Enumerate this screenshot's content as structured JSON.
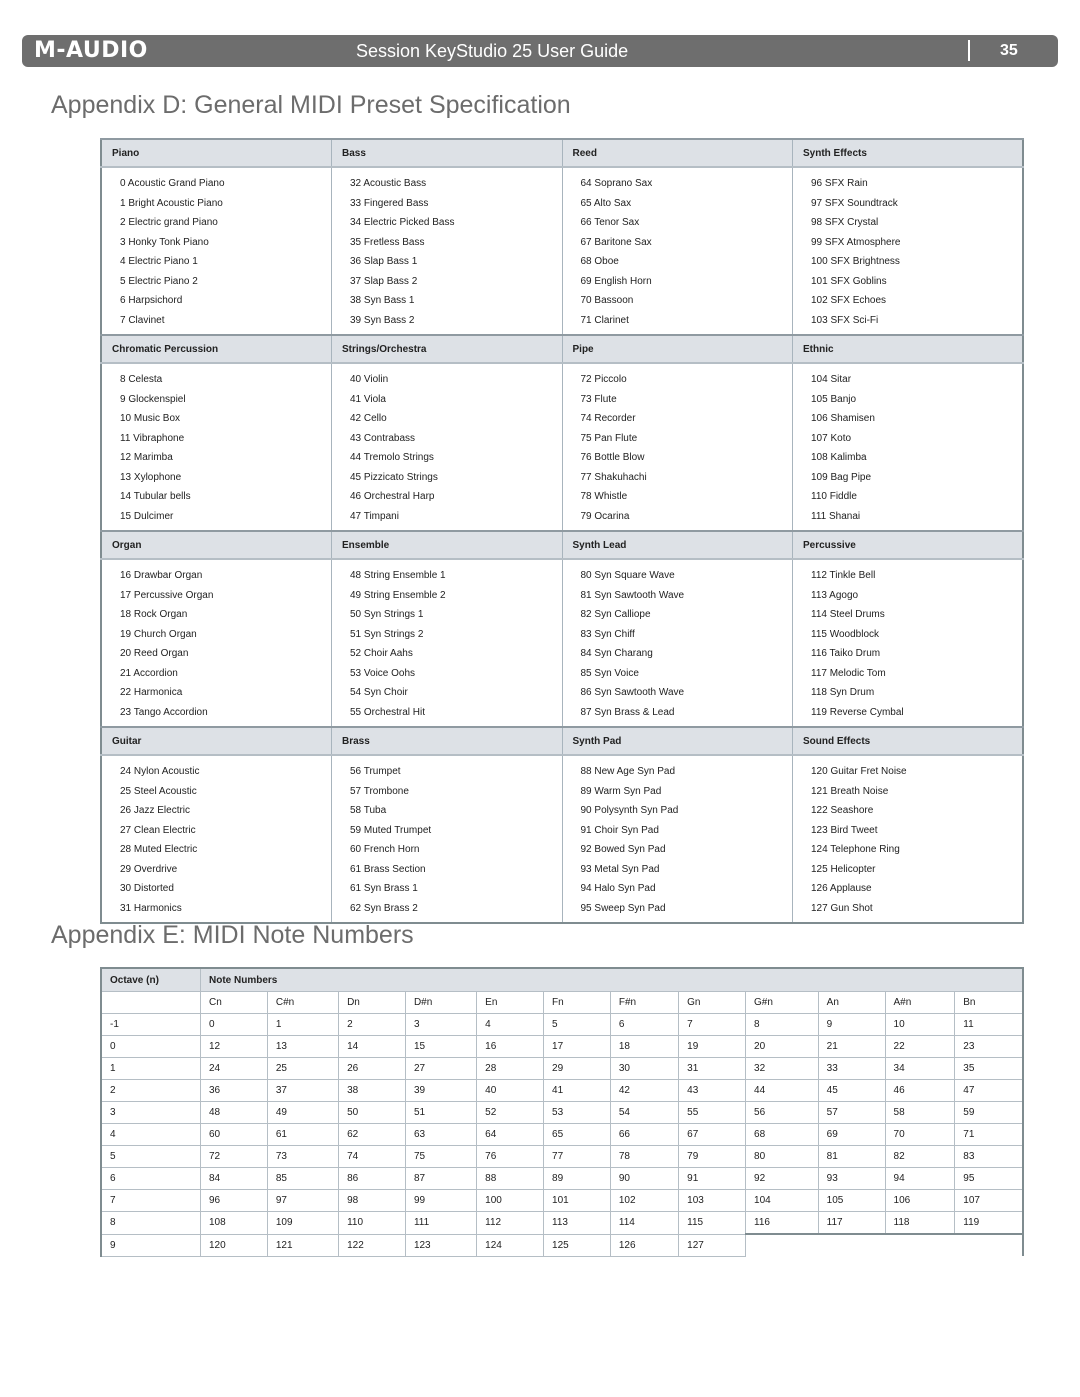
{
  "header": {
    "brand": "M-AUDIO",
    "doc_title": "Session KeyStudio 25 User Guide",
    "page": "35"
  },
  "appendix_d": {
    "title": "Appendix D:  General MIDI Preset Specification",
    "groups": [
      [
        {
          "name": "Piano",
          "items": [
            "0 Acoustic Grand Piano",
            "1 Bright Acoustic Piano",
            "2 Electric grand Piano",
            "3 Honky Tonk Piano",
            "4 Electric Piano 1",
            "5 Electric Piano 2",
            "6 Harpsichord",
            "7 Clavinet"
          ]
        },
        {
          "name": "Bass",
          "items": [
            "32 Acoustic Bass",
            "33 Fingered Bass",
            "34 Electric Picked Bass",
            "35 Fretless Bass",
            "36 Slap Bass 1",
            "37 Slap Bass 2",
            "38 Syn Bass 1",
            "39 Syn Bass 2"
          ]
        },
        {
          "name": "Reed",
          "items": [
            "64 Soprano Sax",
            "65 Alto Sax",
            "66 Tenor Sax",
            "67 Baritone Sax",
            "68 Oboe",
            "69 English Horn",
            "70 Bassoon",
            "71 Clarinet"
          ]
        },
        {
          "name": "Synth Effects",
          "items": [
            "96 SFX Rain",
            "97 SFX Soundtrack",
            "98 SFX Crystal",
            "99 SFX Atmosphere",
            "100 SFX Brightness",
            "101 SFX Goblins",
            "102 SFX Echoes",
            "103 SFX Sci-Fi"
          ]
        }
      ],
      [
        {
          "name": "Chromatic Percussion",
          "items": [
            "8 Celesta",
            "9 Glockenspiel",
            "10 Music Box",
            "11 Vibraphone",
            "12 Marimba",
            "13 Xylophone",
            "14 Tubular bells",
            "15 Dulcimer"
          ]
        },
        {
          "name": "Strings/Orchestra",
          "items": [
            "40 Violin",
            "41 Viola",
            "42 Cello",
            "43 Contrabass",
            "44 Tremolo Strings",
            "45 Pizzicato Strings",
            "46 Orchestral Harp",
            "47 Timpani"
          ]
        },
        {
          "name": "Pipe",
          "items": [
            "72 Piccolo",
            "73 Flute",
            "74 Recorder",
            "75 Pan Flute",
            "76 Bottle Blow",
            "77 Shakuhachi",
            "78 Whistle",
            "79 Ocarina"
          ]
        },
        {
          "name": "Ethnic",
          "items": [
            "104 Sitar",
            "105 Banjo",
            "106 Shamisen",
            "107 Koto",
            "108 Kalimba",
            "109 Bag Pipe",
            "110 Fiddle",
            "111 Shanai"
          ]
        }
      ],
      [
        {
          "name": "Organ",
          "items": [
            "16 Drawbar Organ",
            "17 Percussive Organ",
            "18 Rock Organ",
            "19 Church Organ",
            "20 Reed Organ",
            "21 Accordion",
            "22 Harmonica",
            "23 Tango Accordion"
          ]
        },
        {
          "name": "Ensemble",
          "items": [
            "48 String Ensemble 1",
            "49 String Ensemble 2",
            "50 Syn Strings 1",
            "51 Syn Strings 2",
            "52 Choir Aahs",
            "53 Voice Oohs",
            "54 Syn Choir",
            "55 Orchestral Hit"
          ]
        },
        {
          "name": "Synth Lead",
          "items": [
            "80 Syn Square Wave",
            "81 Syn Sawtooth Wave",
            "82 Syn Calliope",
            "83 Syn Chiff",
            "84 Syn Charang",
            "85 Syn Voice",
            "86 Syn Sawtooth Wave",
            "87 Syn Brass & Lead"
          ]
        },
        {
          "name": "Percussive",
          "items": [
            "112 Tinkle Bell",
            "113 Agogo",
            "114 Steel Drums",
            "115 Woodblock",
            "116 Taiko Drum",
            "117 Melodic Tom",
            "118 Syn Drum",
            "119 Reverse Cymbal"
          ]
        }
      ],
      [
        {
          "name": "Guitar",
          "items": [
            "24 Nylon Acoustic",
            "25 Steel Acoustic",
            "26 Jazz Electric",
            "27 Clean Electric",
            "28 Muted Electric",
            "29 Overdrive",
            "30 Distorted",
            "31 Harmonics"
          ]
        },
        {
          "name": "Brass",
          "items": [
            "56 Trumpet",
            "57 Trombone",
            "58 Tuba",
            "59 Muted Trumpet",
            "60 French Horn",
            "61 Brass Section",
            "61 Syn Brass 1",
            "62 Syn Brass 2"
          ]
        },
        {
          "name": "Synth Pad",
          "items": [
            "88 New Age Syn Pad",
            "89 Warm Syn Pad",
            "90 Polysynth Syn Pad",
            "91 Choir Syn Pad",
            "92 Bowed Syn Pad",
            "93 Metal Syn Pad",
            "94 Halo Syn Pad",
            "95 Sweep Syn Pad"
          ]
        },
        {
          "name": "Sound Effects",
          "items": [
            "120 Guitar Fret Noise",
            "121 Breath Noise",
            "122 Seashore",
            "123 Bird Tweet",
            "124 Telephone Ring",
            "125 Helicopter",
            "126 Applause",
            "127 Gun Shot"
          ]
        }
      ]
    ]
  },
  "appendix_e": {
    "title": "Appendix E: MIDI Note Numbers",
    "octave_header": "Octave (n)",
    "notes_header": "Note Numbers",
    "note_names": [
      "Cn",
      "C#n",
      "Dn",
      "D#n",
      "En",
      "Fn",
      "F#n",
      "Gn",
      "G#n",
      "An",
      "A#n",
      "Bn"
    ],
    "rows": [
      {
        "octave": "-1",
        "values": [
          "0",
          "1",
          "2",
          "3",
          "4",
          "5",
          "6",
          "7",
          "8",
          "9",
          "10",
          "11"
        ]
      },
      {
        "octave": "0",
        "values": [
          "12",
          "13",
          "14",
          "15",
          "16",
          "17",
          "18",
          "19",
          "20",
          "21",
          "22",
          "23"
        ]
      },
      {
        "octave": "1",
        "values": [
          "24",
          "25",
          "26",
          "27",
          "28",
          "29",
          "30",
          "31",
          "32",
          "33",
          "34",
          "35"
        ]
      },
      {
        "octave": "2",
        "values": [
          "36",
          "37",
          "38",
          "39",
          "40",
          "41",
          "42",
          "43",
          "44",
          "45",
          "46",
          "47"
        ]
      },
      {
        "octave": "3",
        "values": [
          "48",
          "49",
          "50",
          "51",
          "52",
          "53",
          "54",
          "55",
          "56",
          "57",
          "58",
          "59"
        ]
      },
      {
        "octave": "4",
        "values": [
          "60",
          "61",
          "62",
          "63",
          "64",
          "65",
          "66",
          "67",
          "68",
          "69",
          "70",
          "71"
        ]
      },
      {
        "octave": "5",
        "values": [
          "72",
          "73",
          "74",
          "75",
          "76",
          "77",
          "78",
          "79",
          "80",
          "81",
          "82",
          "83"
        ]
      },
      {
        "octave": "6",
        "values": [
          "84",
          "85",
          "86",
          "87",
          "88",
          "89",
          "90",
          "91",
          "92",
          "93",
          "94",
          "95"
        ]
      },
      {
        "octave": "7",
        "values": [
          "96",
          "97",
          "98",
          "99",
          "100",
          "101",
          "102",
          "103",
          "104",
          "105",
          "106",
          "107"
        ]
      },
      {
        "octave": "8",
        "values": [
          "108",
          "109",
          "110",
          "111",
          "112",
          "113",
          "114",
          "115",
          "116",
          "117",
          "118",
          "119"
        ]
      },
      {
        "octave": "9",
        "values": [
          "120",
          "121",
          "122",
          "123",
          "124",
          "125",
          "126",
          "127"
        ]
      }
    ]
  }
}
